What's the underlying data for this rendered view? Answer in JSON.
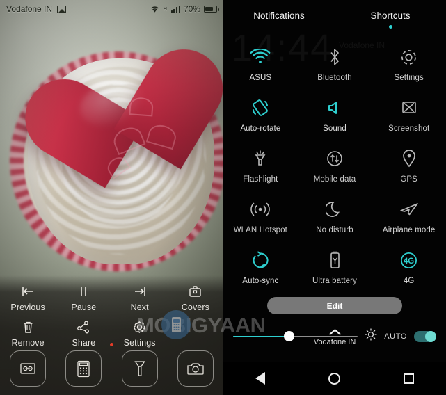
{
  "statusbar": {
    "carrier": "Vodafone IN",
    "image_icon": "image-icon",
    "wifi_icon": "wifi-icon",
    "network_type": "H",
    "signal_icon": "signal-bars-icon",
    "battery_percent": "70%",
    "battery_icon": "battery-icon"
  },
  "wallpaper": {
    "description": "cupcake-with-red-heart-photo"
  },
  "left_controls": {
    "items": [
      {
        "label": "Previous",
        "icon": "skip-previous-icon",
        "dot": false
      },
      {
        "label": "Pause",
        "icon": "pause-icon",
        "dot": false
      },
      {
        "label": "Next",
        "icon": "skip-next-icon",
        "dot": false
      },
      {
        "label": "Covers",
        "icon": "briefcase-icon",
        "dot": false
      },
      {
        "label": "Remove",
        "icon": "trash-icon",
        "dot": false
      },
      {
        "label": "Share",
        "icon": "share-icon",
        "dot": false
      },
      {
        "label": "Settings",
        "icon": "gear-icon",
        "dot": true
      }
    ],
    "dot_color": "#e23c28",
    "apps": [
      {
        "name": "voice-recorder-icon"
      },
      {
        "name": "calculator-icon"
      },
      {
        "name": "flashlight-icon"
      },
      {
        "name": "camera-icon"
      }
    ]
  },
  "ghost": {
    "clock": "14:44",
    "carrier": "Vodafone IN"
  },
  "panel": {
    "tabs": [
      {
        "label": "Notifications",
        "active": false
      },
      {
        "label": "Shortcuts",
        "active": true
      }
    ],
    "accent_color": "#2ecfcf",
    "inactive_color": "#9a9a9a"
  },
  "quick_settings": {
    "tiles": [
      {
        "label": "ASUS",
        "icon": "wifi-icon",
        "active": true
      },
      {
        "label": "Bluetooth",
        "icon": "bluetooth-icon",
        "active": false
      },
      {
        "label": "Settings",
        "icon": "gear-icon",
        "active": false
      },
      {
        "label": "Auto-rotate",
        "icon": "auto-rotate-icon",
        "active": true
      },
      {
        "label": "Sound",
        "icon": "speaker-icon",
        "active": true
      },
      {
        "label": "Screenshot",
        "icon": "screenshot-icon",
        "active": false
      },
      {
        "label": "Flashlight",
        "icon": "flashlight-icon",
        "active": false
      },
      {
        "label": "Mobile data",
        "icon": "mobile-data-icon",
        "active": false
      },
      {
        "label": "GPS",
        "icon": "location-pin-icon",
        "active": false
      },
      {
        "label": "WLAN Hotspot",
        "icon": "hotspot-icon",
        "active": false
      },
      {
        "label": "No disturb",
        "icon": "moon-icon",
        "active": false
      },
      {
        "label": "Airplane mode",
        "icon": "airplane-icon",
        "active": false
      },
      {
        "label": "Auto-sync",
        "icon": "sync-icon",
        "active": true
      },
      {
        "label": "Ultra battery",
        "icon": "battery-saver-icon",
        "active": false
      },
      {
        "label": "4G",
        "icon": "4g-icon",
        "active": true
      }
    ],
    "edit_label": "Edit"
  },
  "brightness": {
    "value_percent": 45,
    "brightness_icon": "sun-icon",
    "auto_label": "AUTO",
    "auto_on": true
  },
  "footer": {
    "collapse_icon": "chevron-up-icon",
    "carrier": "Vodafone IN"
  },
  "navbar": {
    "back": "back-triangle-icon",
    "home": "home-circle-icon",
    "recents": "recents-square-icon"
  },
  "watermark": {
    "text": "MOBIGYAAN",
    "logo": "phone-logo-icon"
  }
}
